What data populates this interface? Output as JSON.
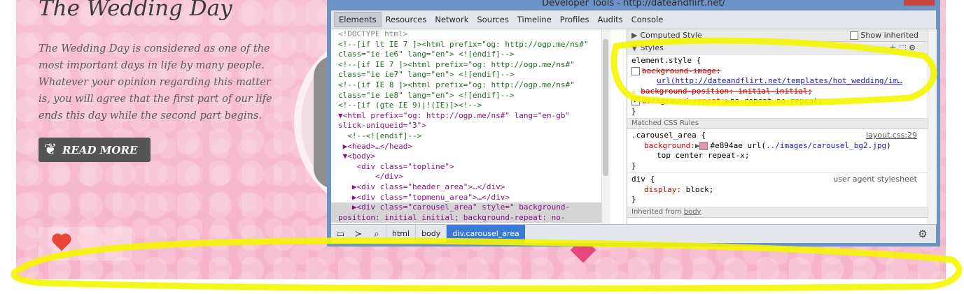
{
  "page": {
    "title": "The Wedding Day",
    "intro": "The Wedding Day is considered as one of the most important days in life by many people. Whatever your opinion regarding this matter is, you will agree that the first part of our life ends this day while the second part begins.",
    "read_more": "READ MORE"
  },
  "devtools": {
    "window_title": "Developer Tools - http://dateandflirt.net/",
    "tabs": [
      "Elements",
      "Resources",
      "Network",
      "Sources",
      "Timeline",
      "Profiles",
      "Audits",
      "Console"
    ],
    "elements": [
      {
        "text": "<!DOCTYPE html>",
        "kind": "gray",
        "indent": 0
      },
      {
        "text": "<!--[if lt IE 7 ]><html prefix=\"og: http://ogp.me/ns#\"",
        "kind": "comment",
        "indent": 0
      },
      {
        "text": "class=\"ie ie6\" lang=\"en\"> <![endif]-->",
        "kind": "comment",
        "indent": 0
      },
      {
        "text": "<!--[if IE 7 ]><html prefix=\"og: http://ogp.me/ns#\"",
        "kind": "comment",
        "indent": 0
      },
      {
        "text": "class=\"ie ie7\" lang=\"en\"> <![endif]-->",
        "kind": "comment",
        "indent": 0
      },
      {
        "text": "<!--[if IE 8 ]><html prefix=\"og: http://ogp.me/ns#\"",
        "kind": "comment",
        "indent": 0
      },
      {
        "text": "class=\"ie ie8\" lang=\"en\"> <![endif]-->",
        "kind": "comment",
        "indent": 0
      },
      {
        "text": "<!--[if (gte IE 9)|!(IE)]><!-->",
        "kind": "comment",
        "indent": 0
      },
      {
        "text": "▼<html prefix=\"og: http://ogp.me/ns#\" lang=\"en-gb\"",
        "kind": "tag",
        "indent": 0
      },
      {
        "text": "slick-uniqueid=\"3\">",
        "kind": "tag",
        "indent": 0
      },
      {
        "text": "  <!--<![endif]-->",
        "kind": "comment",
        "indent": 1
      },
      {
        "text": " ▶<head>…</head>",
        "kind": "tag",
        "indent": 1
      },
      {
        "text": " ▼<body>",
        "kind": "tag",
        "indent": 1
      },
      {
        "text": "    <div class=\"topline\">",
        "kind": "tag",
        "indent": 2
      },
      {
        "text": "        </div>",
        "kind": "tag",
        "indent": 2
      },
      {
        "text": "   ▶<div class=\"header_area\">…</div>",
        "kind": "tag",
        "indent": 2
      },
      {
        "text": "   ▶<div class=\"topmenu_area\">…</div>",
        "kind": "tag",
        "indent": 2
      },
      {
        "text": "   ▶<div class=\"carousel_area\" style=\" background-",
        "kind": "tag",
        "indent": 2,
        "selected": true
      },
      {
        "text": "position: initial initial; background-repeat: no-",
        "kind": "tag",
        "indent": 0,
        "selected": true
      }
    ],
    "styles": {
      "computed_style": "Computed Style",
      "show_inherited": "Show inherited",
      "styles_header": "Styles",
      "element_style_selector": "element.style {",
      "es_bg_image_prop": "background-image:",
      "es_bg_image_url": "url(http://dateandflirt.net/templates/hot_wedding/im…",
      "es_bg_position": "background-position: initial initial;",
      "es_bg_repeat_prop": "background-repeat:",
      "es_bg_repeat_val": "no-repeat no-repeat;",
      "close_brace": "}",
      "matched_header": "Matched CSS Rules",
      "carousel_selector": ".carousel_area {",
      "carousel_source": "layout.css:29",
      "carousel_bg_prop": "background:",
      "carousel_bg_color": "#e894ae",
      "carousel_bg_url_pre": "url(",
      "carousel_bg_url": "../images/carousel_bg2.jpg",
      "carousel_bg_url_post": ")",
      "carousel_bg_line2": "top center repeat-x;",
      "div_selector": "div {",
      "div_source": "user agent stylesheet",
      "div_display": "display:",
      "div_display_val": "block;",
      "inherited_from": "Inherited from",
      "inherited_node": "body"
    },
    "breadcrumbs": [
      "html",
      "body",
      "div.carousel_area"
    ]
  },
  "colors": {
    "site_bg": "#f6b9cc",
    "devtools_frame": "#6b93c6",
    "breadcrumb_active": "#3879d9",
    "highlight": "#f5f500",
    "swatch": "#e894ae"
  }
}
